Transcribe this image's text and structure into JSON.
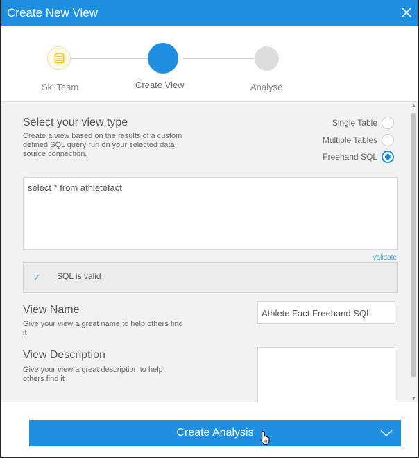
{
  "dialog": {
    "title": "Create New View"
  },
  "stepper": {
    "steps": [
      {
        "label": "Ski Team",
        "state": "complete",
        "icon": "database-icon"
      },
      {
        "label": "Create View",
        "state": "active"
      },
      {
        "label": "Analyse",
        "state": "pending"
      }
    ]
  },
  "view_type": {
    "heading": "Select your view type",
    "description_lines": [
      "Create a view based on the results of a custom",
      "defined SQL query run on your selected data",
      "source connection."
    ],
    "options": [
      {
        "label": "Single Table",
        "selected": false
      },
      {
        "label": "Multiple Tables",
        "selected": false
      },
      {
        "label": "Freehand SQL",
        "selected": true
      }
    ]
  },
  "sql": {
    "query": "select * from athletefact",
    "validate_label": "Validate",
    "status": "SQL is valid"
  },
  "view_name": {
    "heading": "View Name",
    "description_lines": [
      "Give your view a great name to help others find",
      "it"
    ],
    "value": "Athlete Fact Freehand SQL"
  },
  "view_description": {
    "heading": "View Description",
    "description_lines": [
      "Give your view a great description to help",
      "others find it"
    ],
    "value": ""
  },
  "footer": {
    "primary_label": "Create Analysis"
  },
  "colors": {
    "accent": "#1e8fe0",
    "step_complete_bg": "#fffbe6",
    "step_complete_icon": "#f2c318",
    "step_pending": "#dddddd"
  }
}
